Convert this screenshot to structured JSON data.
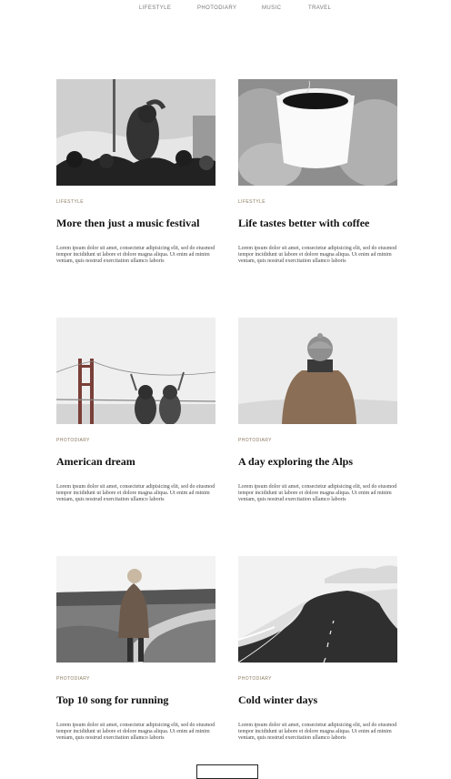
{
  "nav": {
    "items": [
      "LIFESTYLE",
      "PHOTODIARY",
      "MUSIC",
      "TRAVEL"
    ]
  },
  "posts": [
    {
      "category": "LIFESTYLE",
      "title": "More then just a music festival",
      "excerpt": "Lorem ipsum dolor sit amet, consectetur adipisicing elit, sed do eiusmod tempor incididunt ut labore et dolore magna aliqua. Ut enim ad minim veniam, quis nostrud exercitation ullamco laboris"
    },
    {
      "category": "LIFESTYLE",
      "title": "Life tastes better with coffee",
      "excerpt": "Lorem ipsum dolor sit amet, consectetur adipisicing elit, sed do eiusmod tempor incididunt ut labore et dolore magna aliqua. Ut enim ad minim veniam, quis nostrud exercitation ullamco laboris"
    },
    {
      "category": "PHOTODIARY",
      "title": "American dream",
      "excerpt": "Lorem ipsum dolor sit amet, consectetur adipisicing elit, sed do eiusmod tempor incididunt ut labore et dolore magna aliqua. Ut enim ad minim veniam, quis nostrud exercitation ullamco laboris"
    },
    {
      "category": "PHOTODIARY",
      "title": "A day exploring the Alps",
      "excerpt": "Lorem ipsum dolor sit amet, consectetur adipisicing elit, sed do eiusmod tempor incididunt ut labore et dolore magna aliqua. Ut enim ad minim veniam, quis nostrud exercitation ullamco laboris"
    },
    {
      "category": "PHOTODIARY",
      "title": "Top 10 song for running",
      "excerpt": "Lorem ipsum dolor sit amet, consectetur adipisicing elit, sed do eiusmod tempor incididunt ut labore et dolore magna aliqua. Ut enim ad minim veniam, quis nostrud exercitation ullamco laboris"
    },
    {
      "category": "PHOTODIARY",
      "title": "Cold winter days",
      "excerpt": "Lorem ipsum dolor sit amet, consectetur adipisicing elit, sed do eiusmod tempor incididunt ut labore et dolore magna aliqua. Ut enim ad minim veniam, quis nostrud exercitation ullamco laboris"
    }
  ],
  "colors": {
    "category": "#8a7a5f",
    "title": "#111111",
    "nav": "#777777"
  }
}
